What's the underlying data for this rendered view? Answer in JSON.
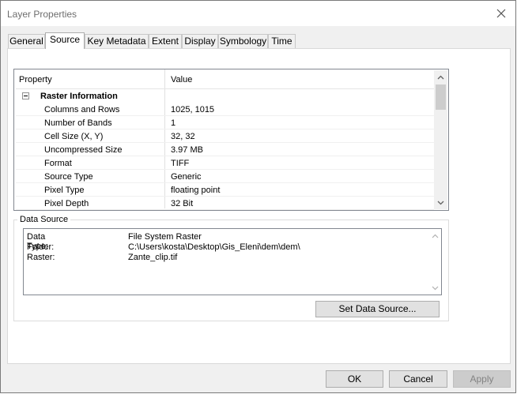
{
  "window": {
    "title": "Layer Properties"
  },
  "tabs": [
    {
      "label": "General"
    },
    {
      "label": "Source"
    },
    {
      "label": "Key Metadata"
    },
    {
      "label": "Extent"
    },
    {
      "label": "Display"
    },
    {
      "label": "Symbology"
    },
    {
      "label": "Time"
    }
  ],
  "active_tab": "Source",
  "grid": {
    "header_property": "Property",
    "header_value": "Value",
    "group_label": "Raster Information",
    "rows": [
      {
        "key": "Columns and Rows",
        "value": "1025, 1015"
      },
      {
        "key": "Number of Bands",
        "value": "1"
      },
      {
        "key": "Cell Size (X, Y)",
        "value": "32, 32"
      },
      {
        "key": "Uncompressed Size",
        "value": "3.97 MB"
      },
      {
        "key": "Format",
        "value": "TIFF"
      },
      {
        "key": "Source Type",
        "value": "Generic"
      },
      {
        "key": "Pixel Type",
        "value": "floating point"
      },
      {
        "key": "Pixel Depth",
        "value": "32 Bit"
      }
    ]
  },
  "data_source": {
    "legend": "Data Source",
    "rows": [
      {
        "key": "Data Type:",
        "value": "File System Raster"
      },
      {
        "key": "Folder:",
        "value": "C:\\Users\\kosta\\Desktop\\Gis_Eleni\\dem\\dem\\"
      },
      {
        "key": "Raster:",
        "value": "Zante_clip.tif"
      }
    ],
    "set_button": "Set Data Source..."
  },
  "buttons": {
    "ok": "OK",
    "cancel": "Cancel",
    "apply": "Apply"
  },
  "icons": {
    "close": "close-icon",
    "collapse": "collapse-icon",
    "scroll_up": "chevron-up-icon",
    "scroll_down": "chevron-down-icon"
  }
}
